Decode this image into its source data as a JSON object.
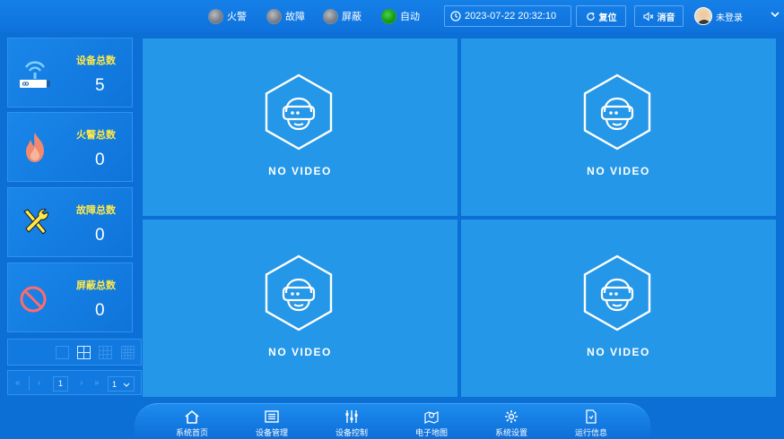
{
  "header": {
    "status": [
      {
        "label": "火警",
        "state": "off"
      },
      {
        "label": "故障",
        "state": "off"
      },
      {
        "label": "屏蔽",
        "state": "off"
      },
      {
        "label": "自动",
        "state": "on"
      }
    ],
    "datetime": "2023-07-22 20:32:10",
    "reset_label": "复位",
    "mute_label": "消音",
    "user_label": "未登录"
  },
  "stats": [
    {
      "label": "设备总数",
      "value": "5",
      "icon": "router-wifi-icon"
    },
    {
      "label": "火警总数",
      "value": "0",
      "icon": "fire-icon"
    },
    {
      "label": "故障总数",
      "value": "0",
      "icon": "tools-icon"
    },
    {
      "label": "屏蔽总数",
      "value": "0",
      "icon": "forbidden-icon"
    }
  ],
  "pager": {
    "current_page": "1",
    "page_select": "1"
  },
  "videos": [
    {
      "text": "NO VIDEO"
    },
    {
      "text": "NO VIDEO"
    },
    {
      "text": "NO VIDEO"
    },
    {
      "text": "NO VIDEO"
    }
  ],
  "nav": [
    {
      "label": "系统首页",
      "icon": "home-icon"
    },
    {
      "label": "设备管理",
      "icon": "device-list-icon"
    },
    {
      "label": "设备控制",
      "icon": "sliders-icon"
    },
    {
      "label": "电子地图",
      "icon": "map-icon"
    },
    {
      "label": "系统设置",
      "icon": "gear-icon"
    },
    {
      "label": "运行信息",
      "icon": "document-icon"
    }
  ],
  "colors": {
    "background": "#0b6fd6",
    "video_cell": "#2597e8",
    "stat_label": "#ffe94a",
    "led_on": "#16a016",
    "led_off": "#7b7f86"
  }
}
